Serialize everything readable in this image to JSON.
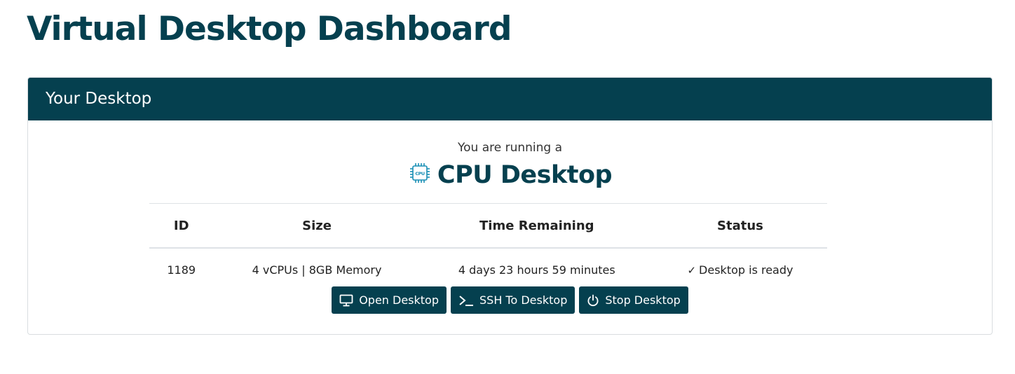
{
  "page": {
    "title": "Virtual Desktop Dashboard"
  },
  "card": {
    "header": "Your Desktop",
    "intro": "You are running a",
    "desktop_type": "CPU Desktop",
    "chip_label": "CPU"
  },
  "table": {
    "headers": {
      "id": "ID",
      "size": "Size",
      "time": "Time Remaining",
      "status": "Status"
    },
    "row": {
      "id": "1189",
      "size": "4 vCPUs |  8GB Memory",
      "time": "4 days 23 hours 59 minutes",
      "status_icon": "✓",
      "status": "Desktop is ready"
    }
  },
  "actions": {
    "open": "Open Desktop",
    "ssh": "SSH To Desktop",
    "stop": "Stop Desktop"
  },
  "icons": {
    "chip": "cpu-chip-icon",
    "open": "monitor-icon",
    "ssh": "terminal-icon",
    "stop": "power-icon"
  },
  "colors": {
    "brand": "#05404f",
    "chip": "#1a8fb5"
  }
}
